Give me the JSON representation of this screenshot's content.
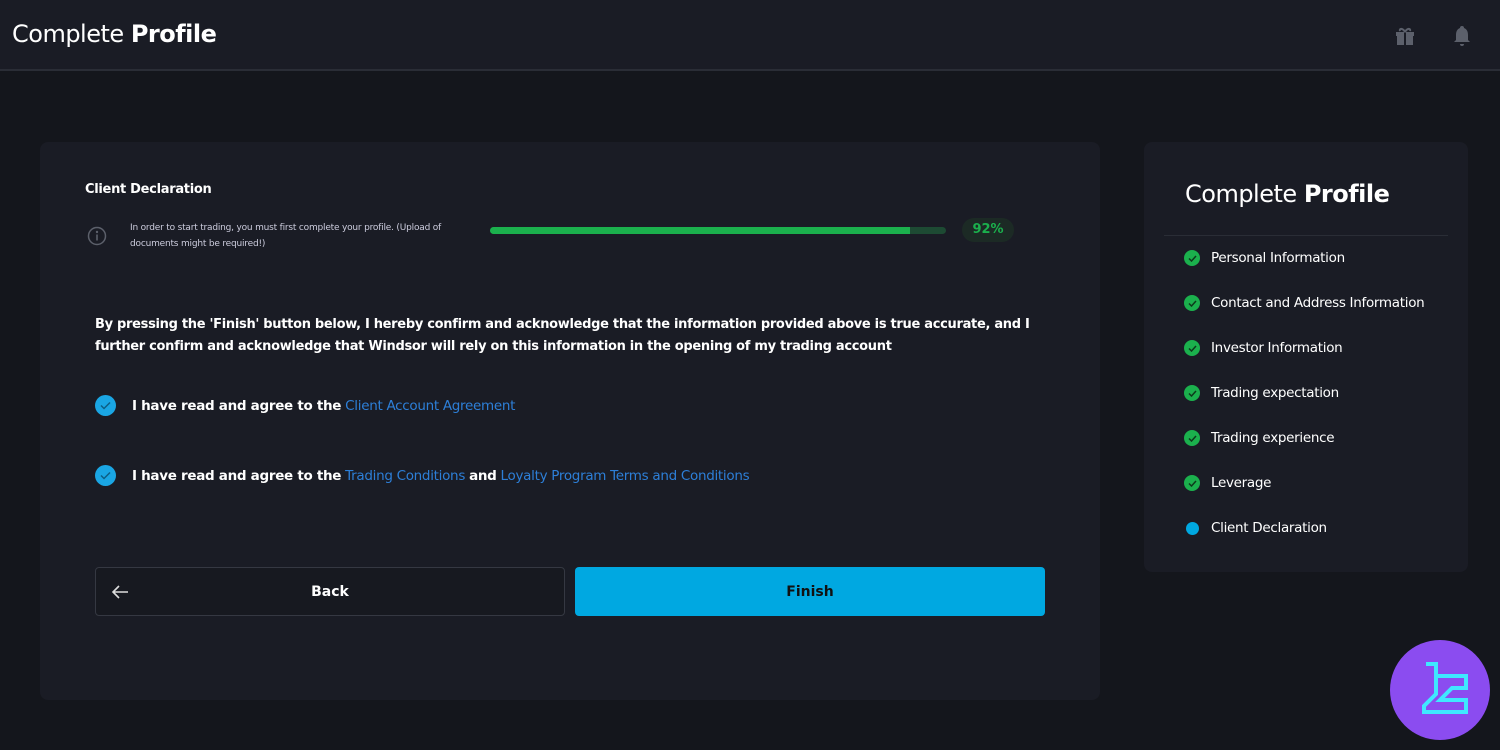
{
  "header": {
    "title_light": "Complete",
    "title_bold": "Profile",
    "icons": [
      "gift-icon",
      "bell-icon"
    ]
  },
  "main": {
    "section_title": "Client Declaration",
    "info_text": "In order to start trading, you must first complete your profile. (Upload of documents might be required!)",
    "progress_percent": 92,
    "progress_label": "92%",
    "declaration": "By pressing the 'Finish' button below, I hereby confirm and acknowledge that the information provided above is true accurate, and I further confirm and acknowledge that Windsor will rely on this information in the opening of my trading account",
    "agreements": [
      {
        "prefix": "I have read and agree to the",
        "link1": "Client Account Agreement",
        "checked": true
      },
      {
        "prefix": "I have read and agree to the",
        "link1": "Trading Conditions",
        "mid": "and",
        "link2": "Loyalty Program Terms and Conditions",
        "checked": true
      }
    ],
    "back_label": "Back",
    "finish_label": "Finish"
  },
  "sidebar": {
    "title_light": "Complete",
    "title_bold": "Profile",
    "steps": [
      {
        "label": "Personal Information",
        "status": "done"
      },
      {
        "label": "Contact and Address Information",
        "status": "done"
      },
      {
        "label": "Investor Information",
        "status": "done"
      },
      {
        "label": "Trading expectation",
        "status": "done"
      },
      {
        "label": "Trading experience",
        "status": "done"
      },
      {
        "label": "Leverage",
        "status": "done"
      },
      {
        "label": "Client Declaration",
        "status": "current"
      }
    ]
  },
  "colors": {
    "accent": "#00a8e1",
    "success": "#1bb04d",
    "link": "#2d7fd8",
    "logo": "#8b4cf0"
  }
}
